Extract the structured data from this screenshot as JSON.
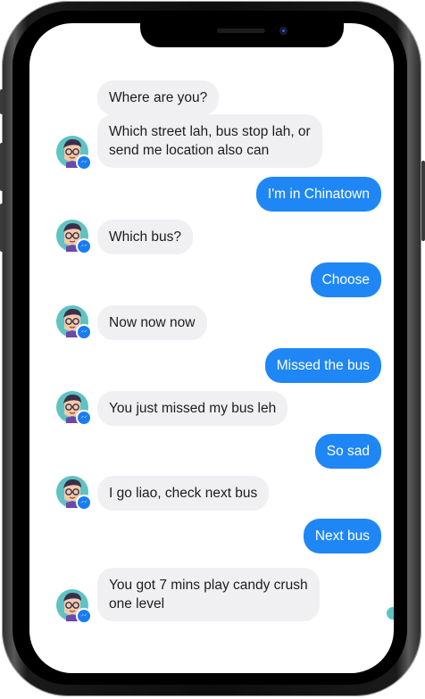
{
  "device": "iPhone X",
  "chat": {
    "messages": [
      {
        "side": "in",
        "text": "Where are you?"
      },
      {
        "side": "in",
        "line1": "Which street lah, bus stop lah, or",
        "line2": "send me location also can"
      },
      {
        "side": "out",
        "text": "I'm in Chinatown"
      },
      {
        "side": "in",
        "text": "Which bus?"
      },
      {
        "side": "out",
        "text": "Choose"
      },
      {
        "side": "in",
        "text": "Now now now"
      },
      {
        "side": "out",
        "text": "Missed the bus"
      },
      {
        "side": "in",
        "text": "You just missed my bus leh"
      },
      {
        "side": "out",
        "text": "So sad"
      },
      {
        "side": "in",
        "text": "I go liao, check next bus"
      },
      {
        "side": "out",
        "text": "Next bus"
      },
      {
        "side": "in",
        "line1": "You got 7 mins play candy crush",
        "line2": "one level"
      }
    ]
  },
  "colors": {
    "incoming_bubble": "#f0f0f2",
    "outgoing_bubble": "#1f87f5",
    "avatar_bg": "#5fc3c3",
    "messenger_badge": "#1a7cf3"
  },
  "icons": {
    "avatar": "bot-avatar-icon",
    "badge": "messenger-badge-icon"
  }
}
